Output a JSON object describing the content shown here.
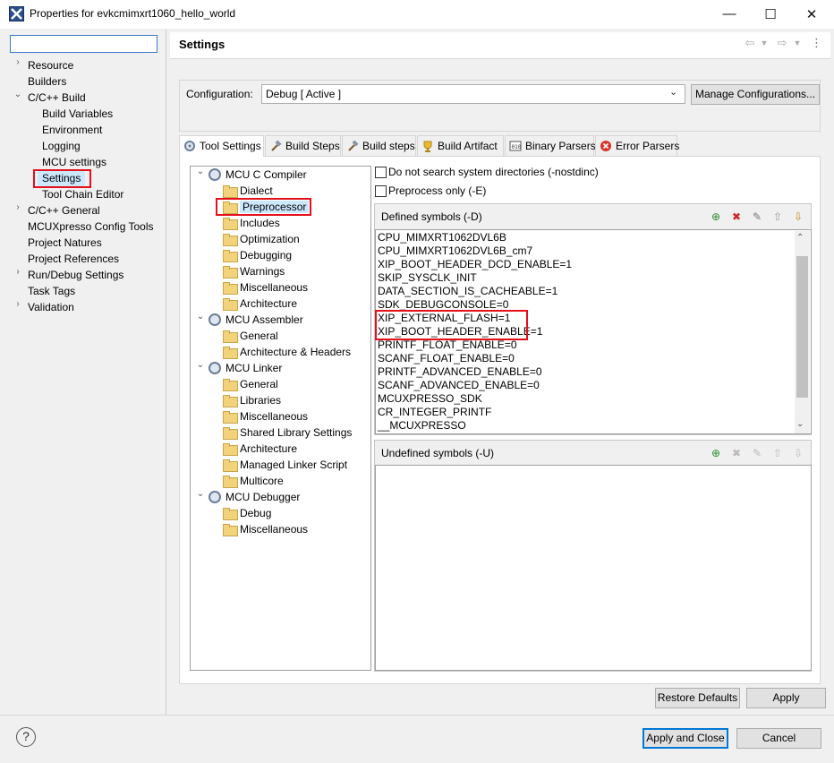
{
  "window": {
    "title": "Properties for evkcmimxrt1060_hello_world",
    "minimize_glyph": "—",
    "maximize_glyph": "☐",
    "close_glyph": "✕"
  },
  "sidebar": {
    "filter_value": "",
    "items": [
      {
        "label": "Resource",
        "twisty": "›"
      },
      {
        "label": "Builders",
        "twisty": ""
      },
      {
        "label": "C/C++ Build",
        "twisty": "⌄"
      },
      {
        "label": "Build Variables",
        "twisty": ""
      },
      {
        "label": "Environment",
        "twisty": ""
      },
      {
        "label": "Logging",
        "twisty": ""
      },
      {
        "label": "MCU settings",
        "twisty": ""
      },
      {
        "label": "Settings",
        "twisty": ""
      },
      {
        "label": "Tool Chain Editor",
        "twisty": ""
      },
      {
        "label": "C/C++ General",
        "twisty": "›"
      },
      {
        "label": "MCUXpresso Config Tools",
        "twisty": ""
      },
      {
        "label": "Project Natures",
        "twisty": ""
      },
      {
        "label": "Project References",
        "twisty": ""
      },
      {
        "label": "Run/Debug Settings",
        "twisty": "›"
      },
      {
        "label": "Task Tags",
        "twisty": ""
      },
      {
        "label": "Validation",
        "twisty": "›"
      }
    ]
  },
  "header": {
    "title": "Settings"
  },
  "configuration": {
    "label": "Configuration:",
    "value": "Debug  [ Active ]",
    "manage_label": "Manage Configurations..."
  },
  "tabs": [
    {
      "label": "Tool Settings"
    },
    {
      "label": "Build Steps"
    },
    {
      "label": "Build steps"
    },
    {
      "label": "Build Artifact"
    },
    {
      "label": "Binary Parsers"
    },
    {
      "label": "Error Parsers"
    }
  ],
  "tool_tree": [
    {
      "label": "MCU C Compiler",
      "kind": "tool"
    },
    {
      "label": "Dialect",
      "kind": "option"
    },
    {
      "label": "Preprocessor",
      "kind": "option"
    },
    {
      "label": "Includes",
      "kind": "option"
    },
    {
      "label": "Optimization",
      "kind": "option"
    },
    {
      "label": "Debugging",
      "kind": "option"
    },
    {
      "label": "Warnings",
      "kind": "option"
    },
    {
      "label": "Miscellaneous",
      "kind": "option"
    },
    {
      "label": "Architecture",
      "kind": "option"
    },
    {
      "label": "MCU Assembler",
      "kind": "tool"
    },
    {
      "label": "General",
      "kind": "option"
    },
    {
      "label": "Architecture & Headers",
      "kind": "option"
    },
    {
      "label": "MCU Linker",
      "kind": "tool"
    },
    {
      "label": "General",
      "kind": "option"
    },
    {
      "label": "Libraries",
      "kind": "option"
    },
    {
      "label": "Miscellaneous",
      "kind": "option"
    },
    {
      "label": "Shared Library Settings",
      "kind": "option"
    },
    {
      "label": "Architecture",
      "kind": "option"
    },
    {
      "label": "Managed Linker Script",
      "kind": "option"
    },
    {
      "label": "Multicore",
      "kind": "option"
    },
    {
      "label": "MCU Debugger",
      "kind": "tool"
    },
    {
      "label": "Debug",
      "kind": "option"
    },
    {
      "label": "Miscellaneous",
      "kind": "option"
    }
  ],
  "options": {
    "nostdinc_label": "Do not search system directories (-nostdinc)",
    "preprocess_only_label": "Preprocess only (-E)"
  },
  "defined_symbols": {
    "title": "Defined symbols (-D)",
    "items": [
      "CPU_MIMXRT1062DVL6B",
      "CPU_MIMXRT1062DVL6B_cm7",
      "XIP_BOOT_HEADER_DCD_ENABLE=1",
      "SKIP_SYSCLK_INIT",
      "DATA_SECTION_IS_CACHEABLE=1",
      "SDK_DEBUGCONSOLE=0",
      "XIP_EXTERNAL_FLASH=1",
      "XIP_BOOT_HEADER_ENABLE=1",
      "PRINTF_FLOAT_ENABLE=0",
      "SCANF_FLOAT_ENABLE=0",
      "PRINTF_ADVANCED_ENABLE=0",
      "SCANF_ADVANCED_ENABLE=0",
      "MCUXPRESSO_SDK",
      "CR_INTEGER_PRINTF",
      "__MCUXPRESSO"
    ]
  },
  "undefined_symbols": {
    "title": "Undefined symbols (-U)"
  },
  "buttons": {
    "restore_defaults": "Restore Defaults",
    "apply": "Apply",
    "apply_and_close": "Apply and Close",
    "cancel": "Cancel",
    "help": "?"
  },
  "colors": {
    "highlight_red": "#e4101c",
    "selection": "#cce8ff",
    "default_button_border": "#0078d7"
  }
}
